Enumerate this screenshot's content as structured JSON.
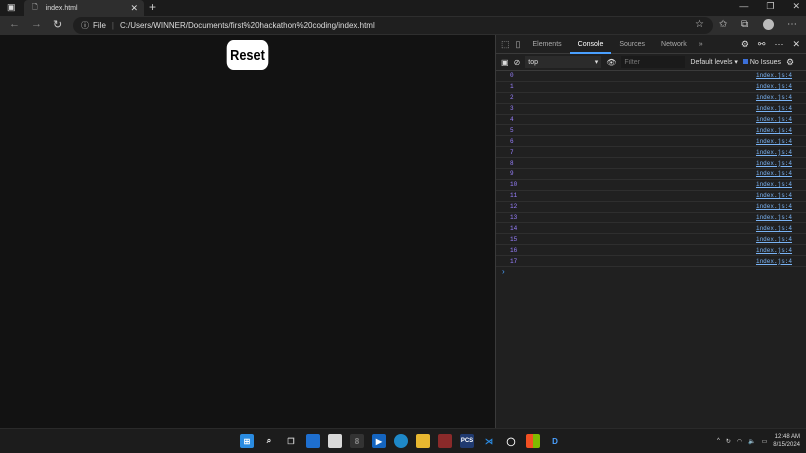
{
  "browser": {
    "tab_title": "index.html",
    "address_prefix": "File",
    "url": "C:/Users/WINNER/Documents/first%20hackathon%20coding/index.html"
  },
  "page": {
    "reset_label": "Reset"
  },
  "devtools": {
    "tabs": [
      "Elements",
      "Console",
      "Sources",
      "Network"
    ],
    "active_tab": "Console",
    "context": "top",
    "filter_placeholder": "Filter",
    "levels": "Default levels",
    "issues": "No Issues",
    "logs": [
      {
        "value": "0",
        "source": "index.js:4"
      },
      {
        "value": "1",
        "source": "index.js:4"
      },
      {
        "value": "2",
        "source": "index.js:4"
      },
      {
        "value": "3",
        "source": "index.js:4"
      },
      {
        "value": "4",
        "source": "index.js:4"
      },
      {
        "value": "5",
        "source": "index.js:4"
      },
      {
        "value": "6",
        "source": "index.js:4"
      },
      {
        "value": "7",
        "source": "index.js:4"
      },
      {
        "value": "8",
        "source": "index.js:4"
      },
      {
        "value": "9",
        "source": "index.js:4"
      },
      {
        "value": "10",
        "source": "index.js:4"
      },
      {
        "value": "11",
        "source": "index.js:4"
      },
      {
        "value": "12",
        "source": "index.js:4"
      },
      {
        "value": "13",
        "source": "index.js:4"
      },
      {
        "value": "14",
        "source": "index.js:4"
      },
      {
        "value": "15",
        "source": "index.js:4"
      },
      {
        "value": "16",
        "source": "index.js:4"
      },
      {
        "value": "17",
        "source": "index.js:4"
      }
    ]
  },
  "taskbar": {
    "time": "12:48 AM",
    "date": "8/15/2024"
  }
}
